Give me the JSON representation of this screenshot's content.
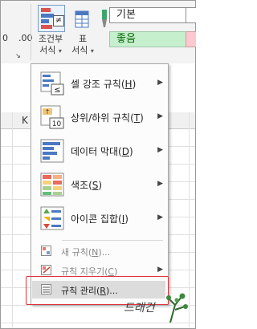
{
  "ribbon": {
    "conditional_formatting": {
      "line1": "조건부",
      "line2": "서식"
    },
    "format_as_table": {
      "line1": "표",
      "line2": "서식"
    },
    "style_normal": "기본",
    "style_good": "좋음"
  },
  "grid": {
    "column_letter": "K"
  },
  "menu": {
    "items": [
      {
        "label": "셀 강조 규칙",
        "key": "H",
        "icon": "highlight-cells-rules-icon"
      },
      {
        "label": "상위/하위 규칙",
        "key": "T",
        "icon": "top-bottom-rules-icon"
      },
      {
        "label": "데이터 막대",
        "key": "D",
        "icon": "data-bars-icon"
      },
      {
        "label": "색조",
        "key": "S",
        "icon": "color-scales-icon"
      },
      {
        "label": "아이콘 집합",
        "key": "I",
        "icon": "icon-sets-icon"
      }
    ],
    "new_rule": {
      "label": "새 규칙",
      "key": "N",
      "suffix": "..."
    },
    "clear_rules": {
      "label": "규칙 지우기",
      "key": "C",
      "suffix": ""
    },
    "manage_rules": {
      "label": "규칙 관리",
      "key": "R",
      "suffix": "..."
    }
  },
  "colors": {
    "accent_red": "#e0313b",
    "good_bg": "#c6efce",
    "good_text": "#006100"
  }
}
